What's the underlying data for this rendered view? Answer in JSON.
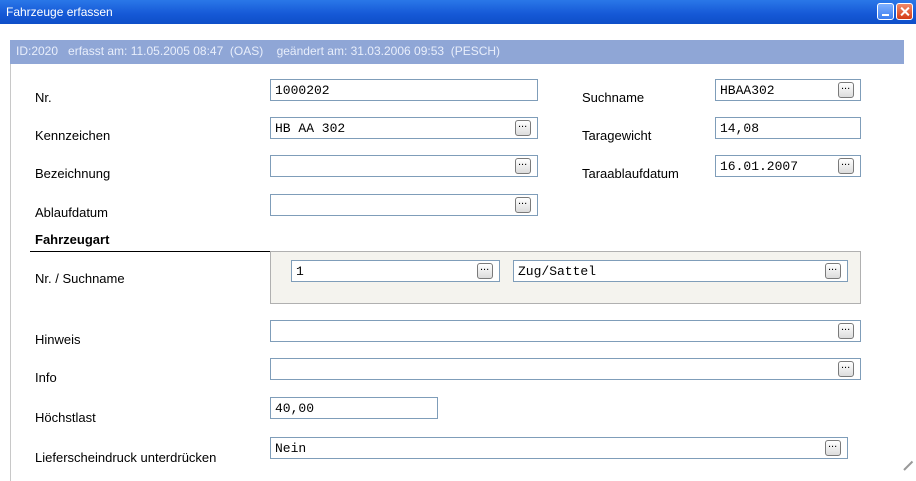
{
  "window": {
    "title": "Fahrzeuge erfassen"
  },
  "info": "ID:2020   erfasst am: 11.05.2005 08:47  (OAS)    geändert am: 31.03.2006 09:53  (PESCH)",
  "fields": {
    "nr": {
      "label": "Nr.",
      "value": "1000202"
    },
    "kennzeichen": {
      "label": "Kennzeichen",
      "value": "HB AA 302"
    },
    "bezeichnung": {
      "label": "Bezeichnung",
      "value": ""
    },
    "ablaufdatum": {
      "label": "Ablaufdatum",
      "value": ""
    },
    "suchname": {
      "label": "Suchname",
      "value": "HBAA302"
    },
    "taragewicht": {
      "label": "Taragewicht",
      "value": "14,08"
    },
    "taraablaufdatum": {
      "label": "Taraablaufdatum",
      "value": "16.01.2007"
    },
    "hinweis": {
      "label": "Hinweis",
      "value": ""
    },
    "info": {
      "label": "Info",
      "value": ""
    },
    "hoechstlast": {
      "label": "Höchstlast",
      "value": "40,00"
    },
    "lieferschein": {
      "label": "Lieferscheindruck unterdrücken",
      "value": "Nein"
    }
  },
  "fahrzeugart": {
    "section_title": "Fahrzeugart",
    "label": "Nr. / Suchname",
    "nr_value": "1",
    "suchname_value": "Zug/Sattel"
  },
  "colors": {
    "titlebar": "#1558d6",
    "infobar": "#8fa6d6",
    "field_border": "#7f9db9"
  }
}
